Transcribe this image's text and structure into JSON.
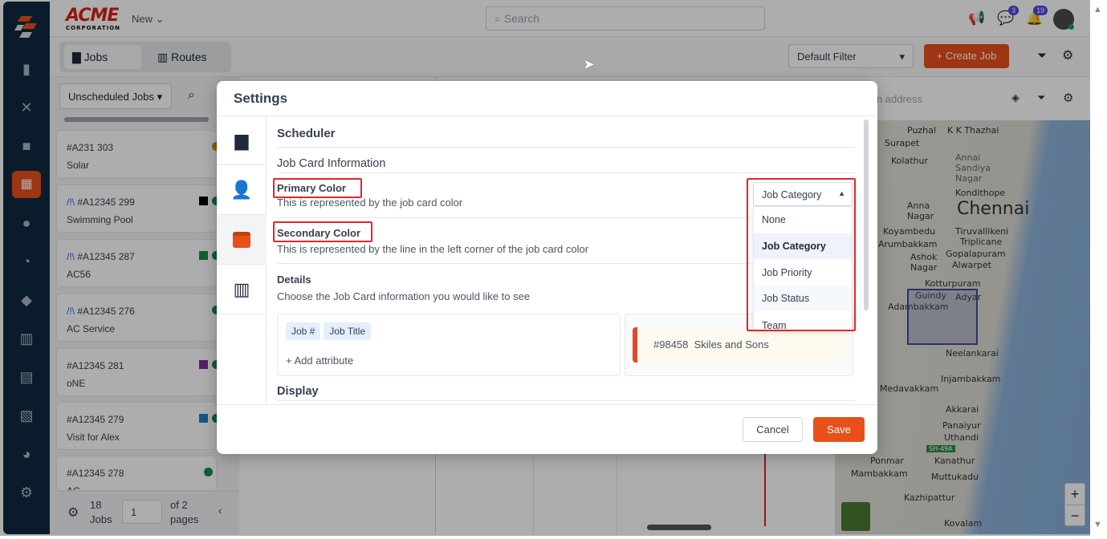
{
  "app": {
    "logo_text": "ACME",
    "logo_sub": "CORPORATION",
    "new_label": "New",
    "search_placeholder": "Search",
    "chat_badge": "3",
    "notif_badge": "19"
  },
  "toolbar": {
    "tabs": [
      {
        "label": "Jobs"
      },
      {
        "label": "Routes"
      }
    ],
    "filter_select": "Default Filter",
    "create_job": "Create Job"
  },
  "jobs": {
    "filter": "Unscheduled Jobs",
    "items": [
      {
        "num": "#A231 303",
        "title": "Solar",
        "color": "#c98a12",
        "route": false
      },
      {
        "num": "#A12345 299",
        "title": "Swimming Pool",
        "color": "#000000",
        "route": true
      },
      {
        "num": "#A12345 287",
        "title": "AC56",
        "color": "#1e8a46",
        "route": true
      },
      {
        "num": "#A12345 276",
        "title": "AC Service",
        "color": "",
        "route": true
      },
      {
        "num": "#A12345 281",
        "title": "oNE",
        "color": "#7b2fa0",
        "route": false
      },
      {
        "num": "#A12345 279",
        "title": "Visit for Alex",
        "color": "#1f7bd1",
        "route": false
      },
      {
        "num": "#A12345 278",
        "title": "AC",
        "color": "",
        "route": false
      }
    ],
    "route_icon": "/!\\",
    "count": "18",
    "count_label": "Jobs",
    "page": "1",
    "of_pages": "of 2",
    "pages_label": "pages"
  },
  "map": {
    "address_placeholder": "Enter an address",
    "labels": [
      "Puzhal",
      "K K Thazhai",
      "Surapet",
      "Kolathur",
      "Annai Sandiya Nagar",
      "Kondithope",
      "Chennai",
      "Anna Nagar",
      "Koyambedu",
      "Tiruvallikeni",
      "Triplicane",
      "Arumbakkam",
      "Gopalapuram",
      "Ashok Nagar",
      "Alwarpet",
      "Kotturpuram",
      "Guindy",
      "Adyar",
      "Adambakkam",
      "Neelankarai",
      "Injambakkam",
      "Medavakkam",
      "Akkarai",
      "Panaiyur",
      "Uthandi",
      "SH-49A",
      "Ponmar",
      "Kanathur",
      "Mambakkam",
      "Muttukadu",
      "Kazhipattur",
      "Kovalam"
    ],
    "zoom_in": "+",
    "zoom_out": "−"
  },
  "modal": {
    "title": "Settings",
    "section": "Scheduler",
    "subsection": "Job Card Information",
    "primary": {
      "label": "Primary Color",
      "desc": "This is represented by the job card color"
    },
    "secondary": {
      "label": "Secondary Color",
      "desc": "This is represented by the line in the left corner of the job card color"
    },
    "details": {
      "label": "Details",
      "desc": "Choose the Job Card information you would like to see",
      "chips": [
        "Job #",
        "Job Title"
      ],
      "add": "+ Add attribute",
      "preview_num": "#98458",
      "preview_name": "Skiles and Sons"
    },
    "display": "Display",
    "dropdown": {
      "value": "Job Category",
      "options": [
        "None",
        "Job Category",
        "Job Priority",
        "Job Status",
        "Team"
      ]
    },
    "cancel": "Cancel",
    "save": "Save"
  },
  "colors": {
    "accent": "#e8501b",
    "highlight": "#e0262c"
  }
}
